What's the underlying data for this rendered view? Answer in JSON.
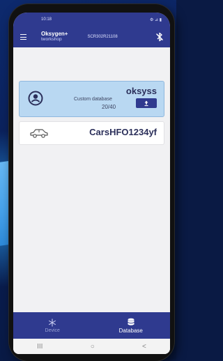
{
  "status_bar": {
    "time": "10:18",
    "right": "⚙ ⊿ ▮"
  },
  "app_bar": {
    "title": "Oksygen+",
    "subtitle": "tworkshop",
    "serial": "SCR302R21108"
  },
  "databases": [
    {
      "name": "oksyss",
      "type": "Custom database",
      "count": "20/40"
    }
  ],
  "cars_entry": {
    "name": "CarsHFO1234yf"
  },
  "bottom_nav": {
    "device_label": "Device",
    "database_label": "Database"
  },
  "system_nav": {
    "recents": "III",
    "home": "○",
    "back": "<"
  },
  "colors": {
    "primary": "#2f3a8f",
    "selected_card": "#b9d8f2"
  },
  "icons": [
    "menu-icon",
    "bluetooth-icon",
    "account-circle-icon",
    "upload-icon",
    "car-icon",
    "snowflake-icon",
    "database-icon"
  ]
}
